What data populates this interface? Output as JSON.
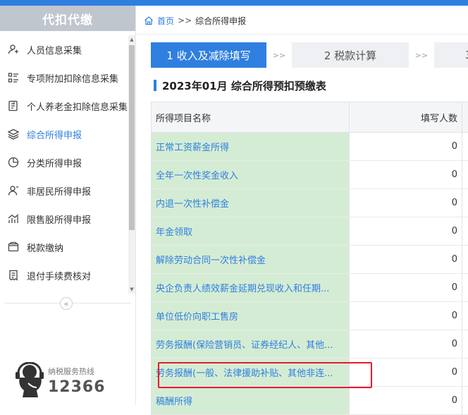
{
  "sidebar": {
    "title": "代扣代缴",
    "items": [
      {
        "label": "人员信息采集",
        "icon": "person-icon",
        "active": false
      },
      {
        "label": "专项附加扣除信息采集",
        "icon": "list-icon",
        "active": false
      },
      {
        "label": "个人养老金扣除信息采集",
        "icon": "document-icon",
        "active": false
      },
      {
        "label": "综合所得申报",
        "icon": "layers-icon",
        "active": true
      },
      {
        "label": "分类所得申报",
        "icon": "pie-chart-icon",
        "active": false
      },
      {
        "label": "非居民所得申报",
        "icon": "user-icon",
        "active": false
      },
      {
        "label": "限售股所得申报",
        "icon": "bar-chart-icon",
        "active": false
      },
      {
        "label": "税款缴纳",
        "icon": "wallet-icon",
        "active": false
      },
      {
        "label": "退付手续费核对",
        "icon": "receipt-icon",
        "active": false
      }
    ],
    "collapse_label": "«",
    "hotline": {
      "label": "纳税服务热线",
      "number": "12366"
    }
  },
  "breadcrumb": {
    "home": "首页",
    "separator": ">>",
    "current": "综合所得申报"
  },
  "steps": [
    {
      "label": "1 收入及减除填写",
      "active": true
    },
    {
      "label": "2 税款计算",
      "active": false
    },
    {
      "label": "3",
      "active": false
    }
  ],
  "step_separator": ">>",
  "page_title": "2023年01月  综合所得预扣预缴表",
  "table": {
    "headers": [
      "所得项目名称",
      "填写人数"
    ],
    "rows": [
      {
        "name": "正常工资薪金所得",
        "count": "0"
      },
      {
        "name": "全年一次性奖金收入",
        "count": "0"
      },
      {
        "name": "内退一次性补偿金",
        "count": "0"
      },
      {
        "name": "年金领取",
        "count": "0"
      },
      {
        "name": "解除劳动合同一次性补偿金",
        "count": "0"
      },
      {
        "name": "央企负责人绩效薪金延期兑现收入和任期...",
        "count": "0"
      },
      {
        "name": "单位低价向职工售房",
        "count": "0"
      },
      {
        "name": "劳务报酬(保险营销员、证券经纪人、其他...",
        "count": "0"
      },
      {
        "name": "劳务报酬(一般、法律援助补贴、其他非连...",
        "count": "0"
      },
      {
        "name": "稿酬所得",
        "count": "0"
      }
    ]
  },
  "colors": {
    "accent": "#2f7fe0",
    "row_bg": "#d5ecd4",
    "highlight": "#e8192c"
  }
}
